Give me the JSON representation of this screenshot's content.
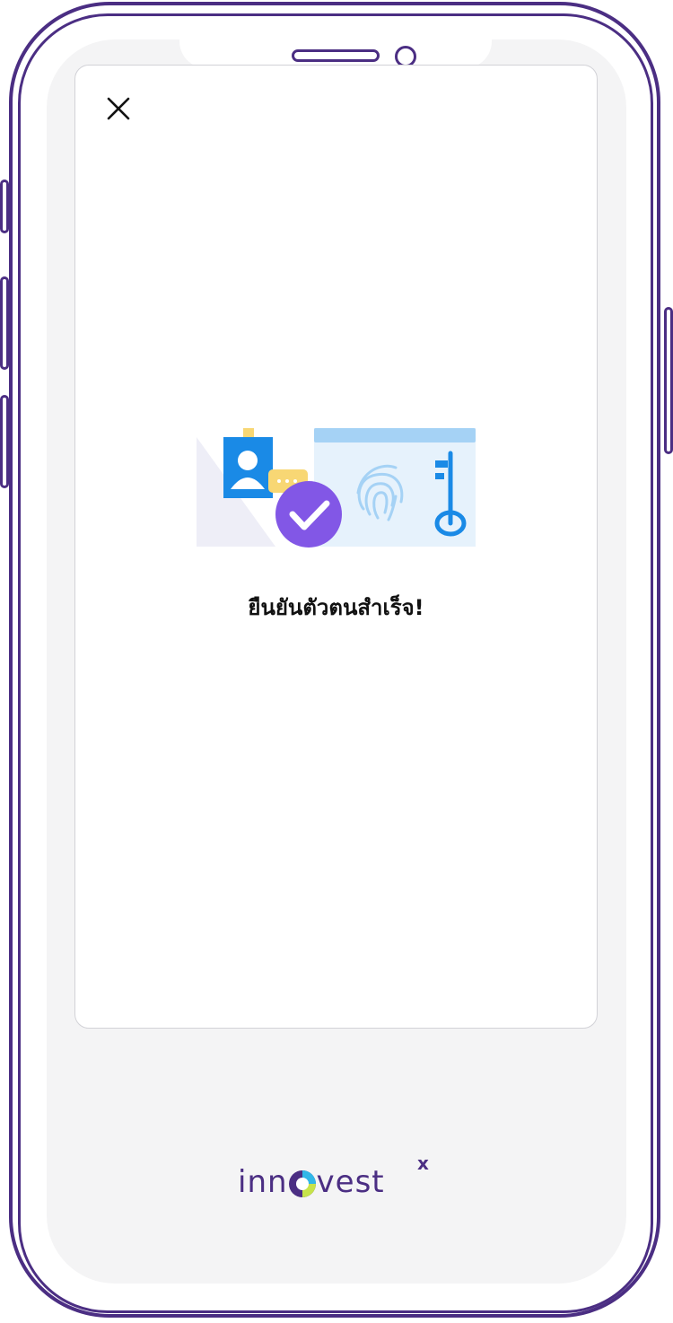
{
  "screen": {
    "close_icon": "close-icon",
    "illustration_icon": "identity-verification-illustration",
    "title": "ยืนยันตัวตนสำเร็จ!"
  },
  "brand": {
    "prefix": "inn",
    "suffix": "vest",
    "superscript": "x"
  },
  "colors": {
    "frame": "#4b2e83",
    "accent_purple": "#8257e6",
    "accent_blue": "#1a8ae6",
    "light_blue": "#e8f3fc",
    "yellow": "#f8d774",
    "bezel": "#f4f4f5"
  }
}
